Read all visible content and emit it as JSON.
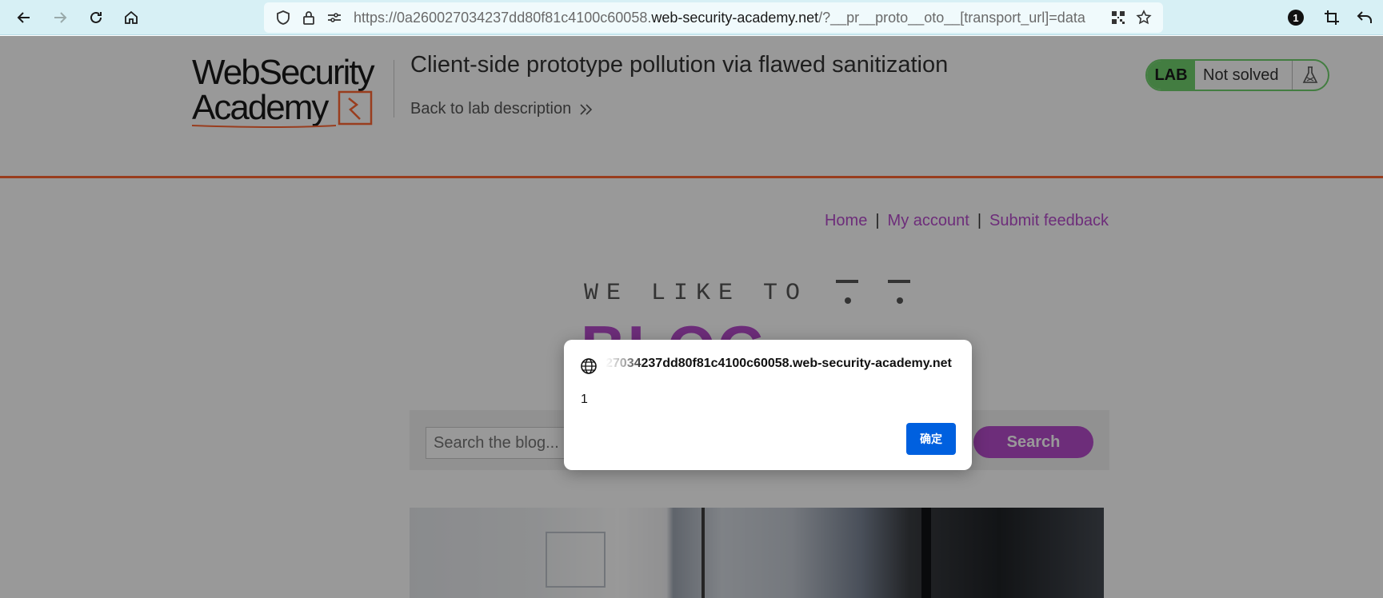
{
  "browser": {
    "url_prefix": "https://0a260027034237dd80f81c4100c60058.",
    "url_host": "web-security-academy.net",
    "url_suffix": "/?__pr__proto__oto__[transport_url]=data",
    "notification_count": "1",
    "icons": [
      "back-icon",
      "forward-icon",
      "reload-icon",
      "home-icon",
      "shield-icon",
      "lock-icon",
      "permissions-icon",
      "qr-code-icon",
      "star-icon",
      "extension-badge-icon",
      "screenshot-icon",
      "undo-icon"
    ]
  },
  "header": {
    "logo_line1": "WebSecurity",
    "logo_line2": "Academy",
    "lab_title": "Client-side prototype pollution via flawed sanitization",
    "back_link": "Back to lab description",
    "badge_label": "LAB",
    "badge_status": "Not solved"
  },
  "nav": {
    "home": "Home",
    "my_account": "My account",
    "submit_feedback": "Submit feedback",
    "separator": "|"
  },
  "hero": {
    "tagline": "WE LIKE TO",
    "title": "BLOG"
  },
  "search": {
    "placeholder": "Search the blog...",
    "button": "Search"
  },
  "dialog": {
    "origin": "27034237dd80f81c4100c60058.web-security-academy.net",
    "message": "1",
    "ok_label": "确定"
  },
  "colors": {
    "accent_purple": "#b64ccc",
    "orange": "#ff6633",
    "lab_green": "#70d16d",
    "ok_blue": "#0060df"
  }
}
